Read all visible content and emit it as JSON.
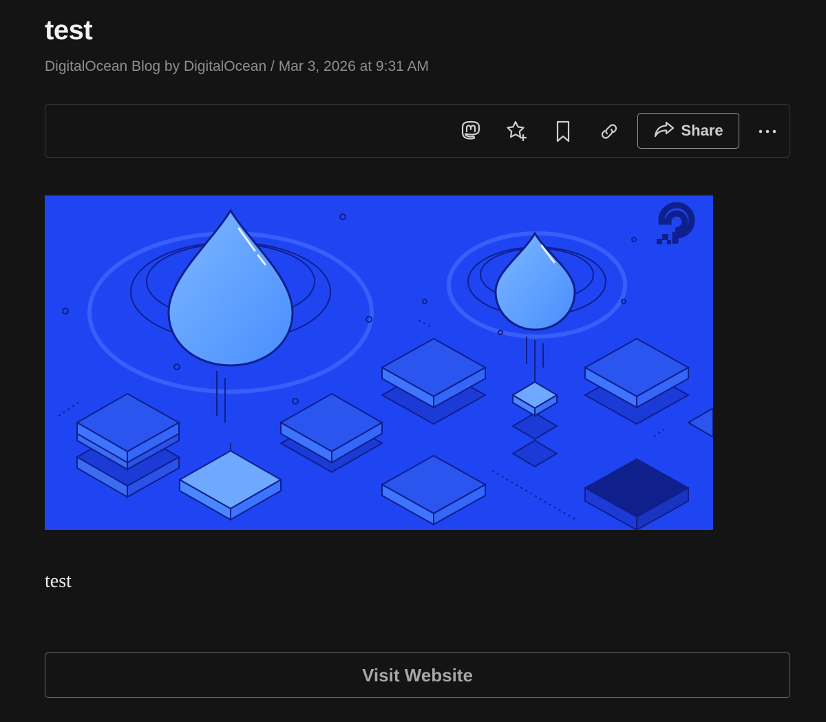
{
  "article": {
    "title": "test",
    "source": "DigitalOcean Blog by DigitalOcean",
    "separator": " / ",
    "date": "Mar 3, 2026 at 9:31 AM",
    "body": "test"
  },
  "toolbar": {
    "icons": [
      "mastodon-icon",
      "star-plus-icon",
      "bookmark-icon",
      "link-icon",
      "share-arrow-icon",
      "more-horizontal-icon"
    ],
    "share_label": "Share"
  },
  "hero": {
    "background_color": "#1f45f3",
    "accent_color": "#5aa0ff",
    "dark_color": "#1227b8",
    "logo_icon": "digitalocean-logo-icon"
  },
  "footer": {
    "visit_label": "Visit Website"
  }
}
